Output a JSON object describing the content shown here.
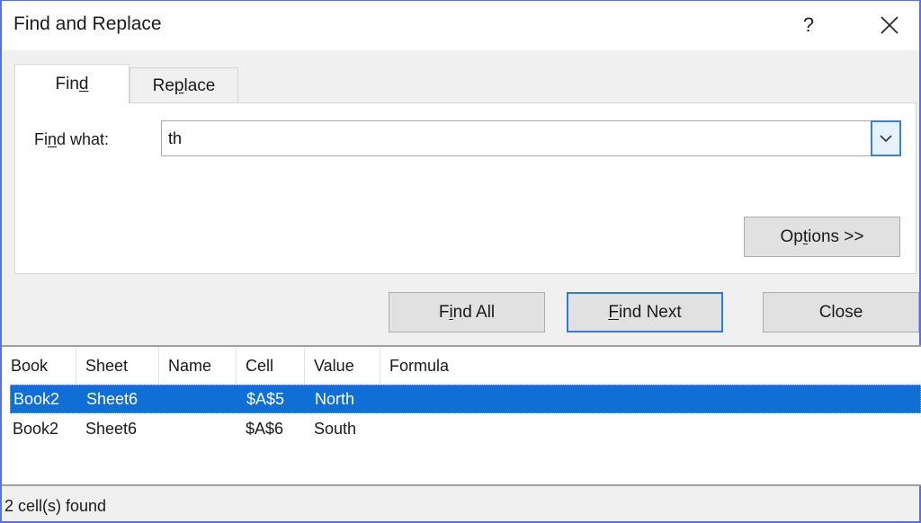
{
  "window": {
    "title": "Find and Replace",
    "help_label": "?",
    "close_label": "✕"
  },
  "tabs": [
    {
      "label_pre": "Fin",
      "label_u": "d",
      "label_post": "",
      "active": true
    },
    {
      "label_pre": "Re",
      "label_u": "p",
      "label_post": "lace",
      "active": false
    }
  ],
  "find": {
    "label_pre": "Fi",
    "label_u": "n",
    "label_post": "d what:",
    "value": "th",
    "dropdown_icon": "chevron-down-icon"
  },
  "buttons": {
    "options": {
      "pre": "Op",
      "u": "t",
      "post": "ions >>"
    },
    "find_all": {
      "pre": "F",
      "u": "i",
      "post": "nd All"
    },
    "find_next": {
      "pre": "",
      "u": "F",
      "post": "ind Next"
    },
    "close": "Close"
  },
  "results": {
    "columns": [
      "Book",
      "Sheet",
      "Name",
      "Cell",
      "Value",
      "Formula"
    ],
    "rows": [
      {
        "book": "Book2",
        "sheet": "Sheet6",
        "name": "",
        "cell": "$A$5",
        "value": "North",
        "formula": "",
        "selected": true
      },
      {
        "book": "Book2",
        "sheet": "Sheet6",
        "name": "",
        "cell": "$A$6",
        "value": "South",
        "formula": "",
        "selected": false
      }
    ]
  },
  "status": "2 cell(s) found",
  "colors": {
    "selection": "#0f6fd6",
    "focus_border": "#2f7bd6",
    "window_border": "#5a6fe0"
  }
}
